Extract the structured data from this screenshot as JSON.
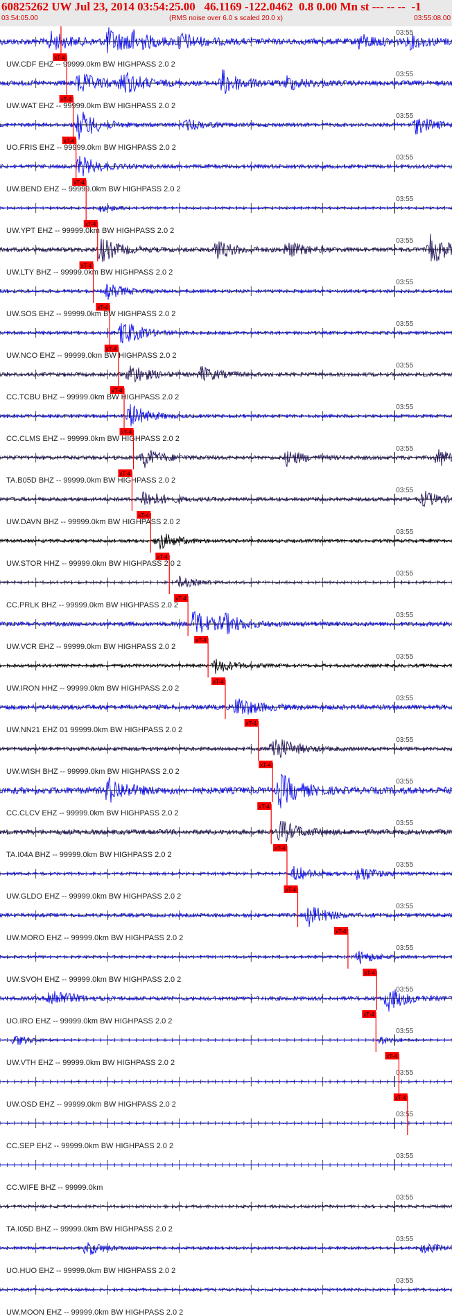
{
  "header": {
    "title": "60825262 UW Jul 23, 2014 03:54:25.00   46.1169 -122.0462  0.8 0.00 Mn st --- -- --  -1",
    "start_time": "03:54:05.00",
    "note": "(RMS noise over 6.0 s scaled 20.0 x)",
    "end_time": "03:55:08.00"
  },
  "colors": {
    "header_text": "#e00000",
    "pick_box": "#ff0000",
    "pick_line": "#ff0000",
    "blue_trace": "#1010ee",
    "dark_trace": "#231458",
    "black_trace": "#000000"
  },
  "chart_data": {
    "type": "line",
    "time_range": [
      "03:54:05.00",
      "03:55:08.00"
    ],
    "tick_label": "03:55",
    "tick_label_time": "03:55:00",
    "pick_label": "xT-4",
    "traces": [
      {
        "label": "UW.CDF EHZ -- 99999.0km BW  HIGHPASS  2.0  2",
        "color": "blue",
        "pick": "03:54:13.5",
        "amp": 1.0,
        "events": [
          [
            "03:54:12",
            0.9
          ],
          [
            "03:54:20",
            1.3
          ],
          [
            "03:54:23",
            1.0
          ],
          [
            "03:54:30",
            0.8
          ],
          [
            "03:54:55",
            0.7
          ],
          [
            "03:55:02",
            0.6
          ]
        ]
      },
      {
        "label": "UW.WAT EHZ -- 99999.0km BW  HIGHPASS  2.0  2",
        "color": "blue",
        "pick": "03:54:14.3",
        "amp": 0.8,
        "events": [
          [
            "03:54:16",
            1.1
          ],
          [
            "03:54:22",
            1.3
          ],
          [
            "03:54:36",
            1.3
          ],
          [
            "03:54:45",
            0.7
          ]
        ]
      },
      {
        "label": "UO.FRIS EHZ -- 99999.0km BW  HIGHPASS  2.0  2",
        "color": "blue",
        "pick": "03:54:15.2",
        "amp": 0.6,
        "events": [
          [
            "03:54:16",
            1.6
          ],
          [
            "03:54:31",
            0.5
          ],
          [
            "03:55:03",
            0.9
          ]
        ]
      },
      {
        "label": "UW.BEND EHZ -- 99999.0km BW  HIGHPASS  2.0  2",
        "color": "blue",
        "pick": "03:54:15.6",
        "amp": 0.6,
        "events": [
          [
            "03:54:16",
            1.1
          ]
        ]
      },
      {
        "label": "UW.YPT EHZ -- 99999.0km BW  HIGHPASS  2.0  2",
        "color": "blue",
        "pick": "03:54:17.0",
        "amp": 0.3,
        "events": [
          [
            "03:54:19",
            0.4
          ]
        ]
      },
      {
        "label": "UW.LTY BHZ -- 99999.0km BW  HIGHPASS  2.0  2",
        "color": "dark",
        "pick": "03:54:18.6",
        "amp": 0.7,
        "events": [
          [
            "03:54:19",
            1.3
          ],
          [
            "03:54:35",
            1.0
          ],
          [
            "03:54:45",
            0.8
          ],
          [
            "03:55:05",
            1.5
          ]
        ]
      },
      {
        "label": "UW.SOS EHZ -- 99999.0km BW  HIGHPASS  2.0  2",
        "color": "blue",
        "pick": "03:54:18.0",
        "amp": 0.5,
        "events": [
          [
            "03:54:20",
            0.8
          ]
        ]
      },
      {
        "label": "UW.NCO EHZ -- 99999.0km BW  HIGHPASS  2.0  2",
        "color": "blue",
        "pick": "03:54:20.3",
        "amp": 0.5,
        "events": [
          [
            "03:54:22",
            1.5
          ]
        ]
      },
      {
        "label": "CC.TCBU BHZ -- 99999.0km BW  HIGHPASS  2.0  2",
        "color": "dark",
        "pick": "03:54:21.5",
        "amp": 0.6,
        "events": [
          [
            "03:54:23",
            1.1
          ],
          [
            "03:54:33",
            0.8
          ]
        ]
      },
      {
        "label": "CC.CLMS EHZ -- 99999.0km BW  HIGHPASS  2.0  2",
        "color": "blue",
        "pick": "03:54:22.3",
        "amp": 0.5,
        "events": [
          [
            "03:54:23",
            1.3
          ]
        ]
      },
      {
        "label": "TA.B05D BHZ -- 99999.0km BW  HIGHPASS  2.0  2",
        "color": "dark",
        "pick": "03:54:23.6",
        "amp": 0.6,
        "events": [
          [
            "03:54:25",
            1.0
          ],
          [
            "03:54:45",
            0.8
          ],
          [
            "03:55:06",
            0.9
          ]
        ]
      },
      {
        "label": "UW.DAVN BHZ -- 99999.0km BW  HIGHPASS  2.0  2",
        "color": "dark",
        "pick": "03:54:23.4",
        "amp": 0.6,
        "events": [
          [
            "03:54:25",
            1.0
          ],
          [
            "03:55:04",
            0.8
          ]
        ]
      },
      {
        "label": "UW.STOR HHZ -- 99999.0km BW  HIGHPASS  2.0  2",
        "color": "black",
        "pick": "03:54:26.0",
        "amp": 0.5,
        "events": [
          [
            "03:54:27",
            1.0
          ]
        ]
      },
      {
        "label": "CC.PRLK BHZ -- 99999.0km BW  HIGHPASS  2.0  2",
        "color": "dark",
        "pick": "03:54:28.6",
        "amp": 0.3,
        "events": [
          [
            "03:54:30",
            0.6
          ]
        ]
      },
      {
        "label": "UW.VCR EHZ -- 99999.0km BW  HIGHPASS  2.0  2",
        "color": "blue",
        "pick": "03:54:31.2",
        "amp": 0.7,
        "events": [
          [
            "03:54:32",
            1.4
          ],
          [
            "03:54:36",
            1.0
          ]
        ]
      },
      {
        "label": "UW.IRON HHZ -- 99999.0km BW  HIGHPASS  2.0  2",
        "color": "black",
        "pick": "03:54:34.0",
        "amp": 0.5,
        "events": [
          [
            "03:54:35",
            0.8
          ]
        ]
      },
      {
        "label": "UW.NN21 EHZ 01 99999.0km BW  HIGHPASS  2.0  2",
        "color": "blue",
        "pick": "03:54:36.4",
        "amp": 0.8,
        "events": [
          [
            "03:54:38",
            1.1
          ]
        ]
      },
      {
        "label": "UW.WISH BHZ -- 99999.0km BW  HIGHPASS  2.0  2",
        "color": "dark",
        "pick": "03:54:41.0",
        "amp": 0.6,
        "events": [
          [
            "03:54:43",
            1.6
          ]
        ]
      },
      {
        "label": "CC.CLCV EHZ -- 99999.0km BW  HIGHPASS  2.0  2",
        "color": "blue",
        "pick": "03:54:43.0",
        "amp": 1.1,
        "events": [
          [
            "03:54:44",
            1.7
          ],
          [
            "03:54:20",
            1.3
          ]
        ]
      },
      {
        "label": "TA.I04A BHZ -- 99999.0km BW  HIGHPASS  2.0  2",
        "color": "dark",
        "pick": "03:54:42.8",
        "amp": 0.8,
        "events": [
          [
            "03:54:44",
            1.2
          ]
        ]
      },
      {
        "label": "UW.GLDO EHZ -- 99999.0km BW  HIGHPASS  2.0  2",
        "color": "blue",
        "pick": "03:54:45.0",
        "amp": 0.4,
        "events": [
          [
            "03:54:46",
            0.8
          ],
          [
            "03:54:55",
            0.9
          ]
        ]
      },
      {
        "label": "UW.MORO EHZ -- 99999.0km BW  HIGHPASS  2.0  2",
        "color": "blue",
        "pick": "03:54:46.5",
        "amp": 0.6,
        "events": [
          [
            "03:54:48",
            1.1
          ]
        ]
      },
      {
        "label": "UW.SVOH EHZ -- 99999.0km BW  HIGHPASS  2.0  2",
        "color": "blue",
        "pick": "03:54:53.5",
        "amp": 0.4,
        "events": [
          [
            "03:54:55",
            0.7
          ]
        ]
      },
      {
        "label": "UO.IRO EHZ -- 99999.0km BW  HIGHPASS  2.0  2",
        "color": "blue",
        "pick": "03:54:57.5",
        "amp": 0.6,
        "events": [
          [
            "03:54:12",
            1.2
          ],
          [
            "03:54:59",
            1.3
          ]
        ]
      },
      {
        "label": "UW.VTH EHZ -- 99999.0km BW  HIGHPASS  2.0  2",
        "color": "blue",
        "pick": "03:54:57.4",
        "amp": 0.1,
        "events": [
          [
            "03:54:07",
            0.7
          ],
          [
            "03:54:58",
            0.5
          ]
        ]
      },
      {
        "label": "UW.OSD EHZ -- 99999.0km BW  HIGHPASS  2.0  2",
        "color": "blue",
        "pick": "03:55:00.6",
        "amp": 0.2,
        "events": []
      },
      {
        "label": "CC.SEP EHZ -- 99999.0km BW  HIGHPASS  2.0  2",
        "color": "blue",
        "pick": "03:55:01.8",
        "amp": 0.15,
        "events": []
      },
      {
        "label": "CC.WIFE BHZ -- 99999.0km",
        "color": "blue",
        "pick": null,
        "amp": 0.0,
        "events": []
      },
      {
        "label": "TA.I05D BHZ -- 99999.0km BW  HIGHPASS  2.0  2",
        "color": "dark",
        "pick": null,
        "amp": 0.4,
        "events": []
      },
      {
        "label": "UO.HUO EHZ -- 99999.0km BW  HIGHPASS  2.0  2",
        "color": "blue",
        "pick": null,
        "amp": 0.4,
        "events": [
          [
            "03:54:17",
            0.8
          ],
          [
            "03:55:04",
            0.6
          ]
        ]
      },
      {
        "label": "UW.MOON EHZ -- 99999.0km BW  HIGHPASS  2.0  2",
        "color": "blue",
        "pick": null,
        "amp": 0.4,
        "events": []
      }
    ]
  }
}
